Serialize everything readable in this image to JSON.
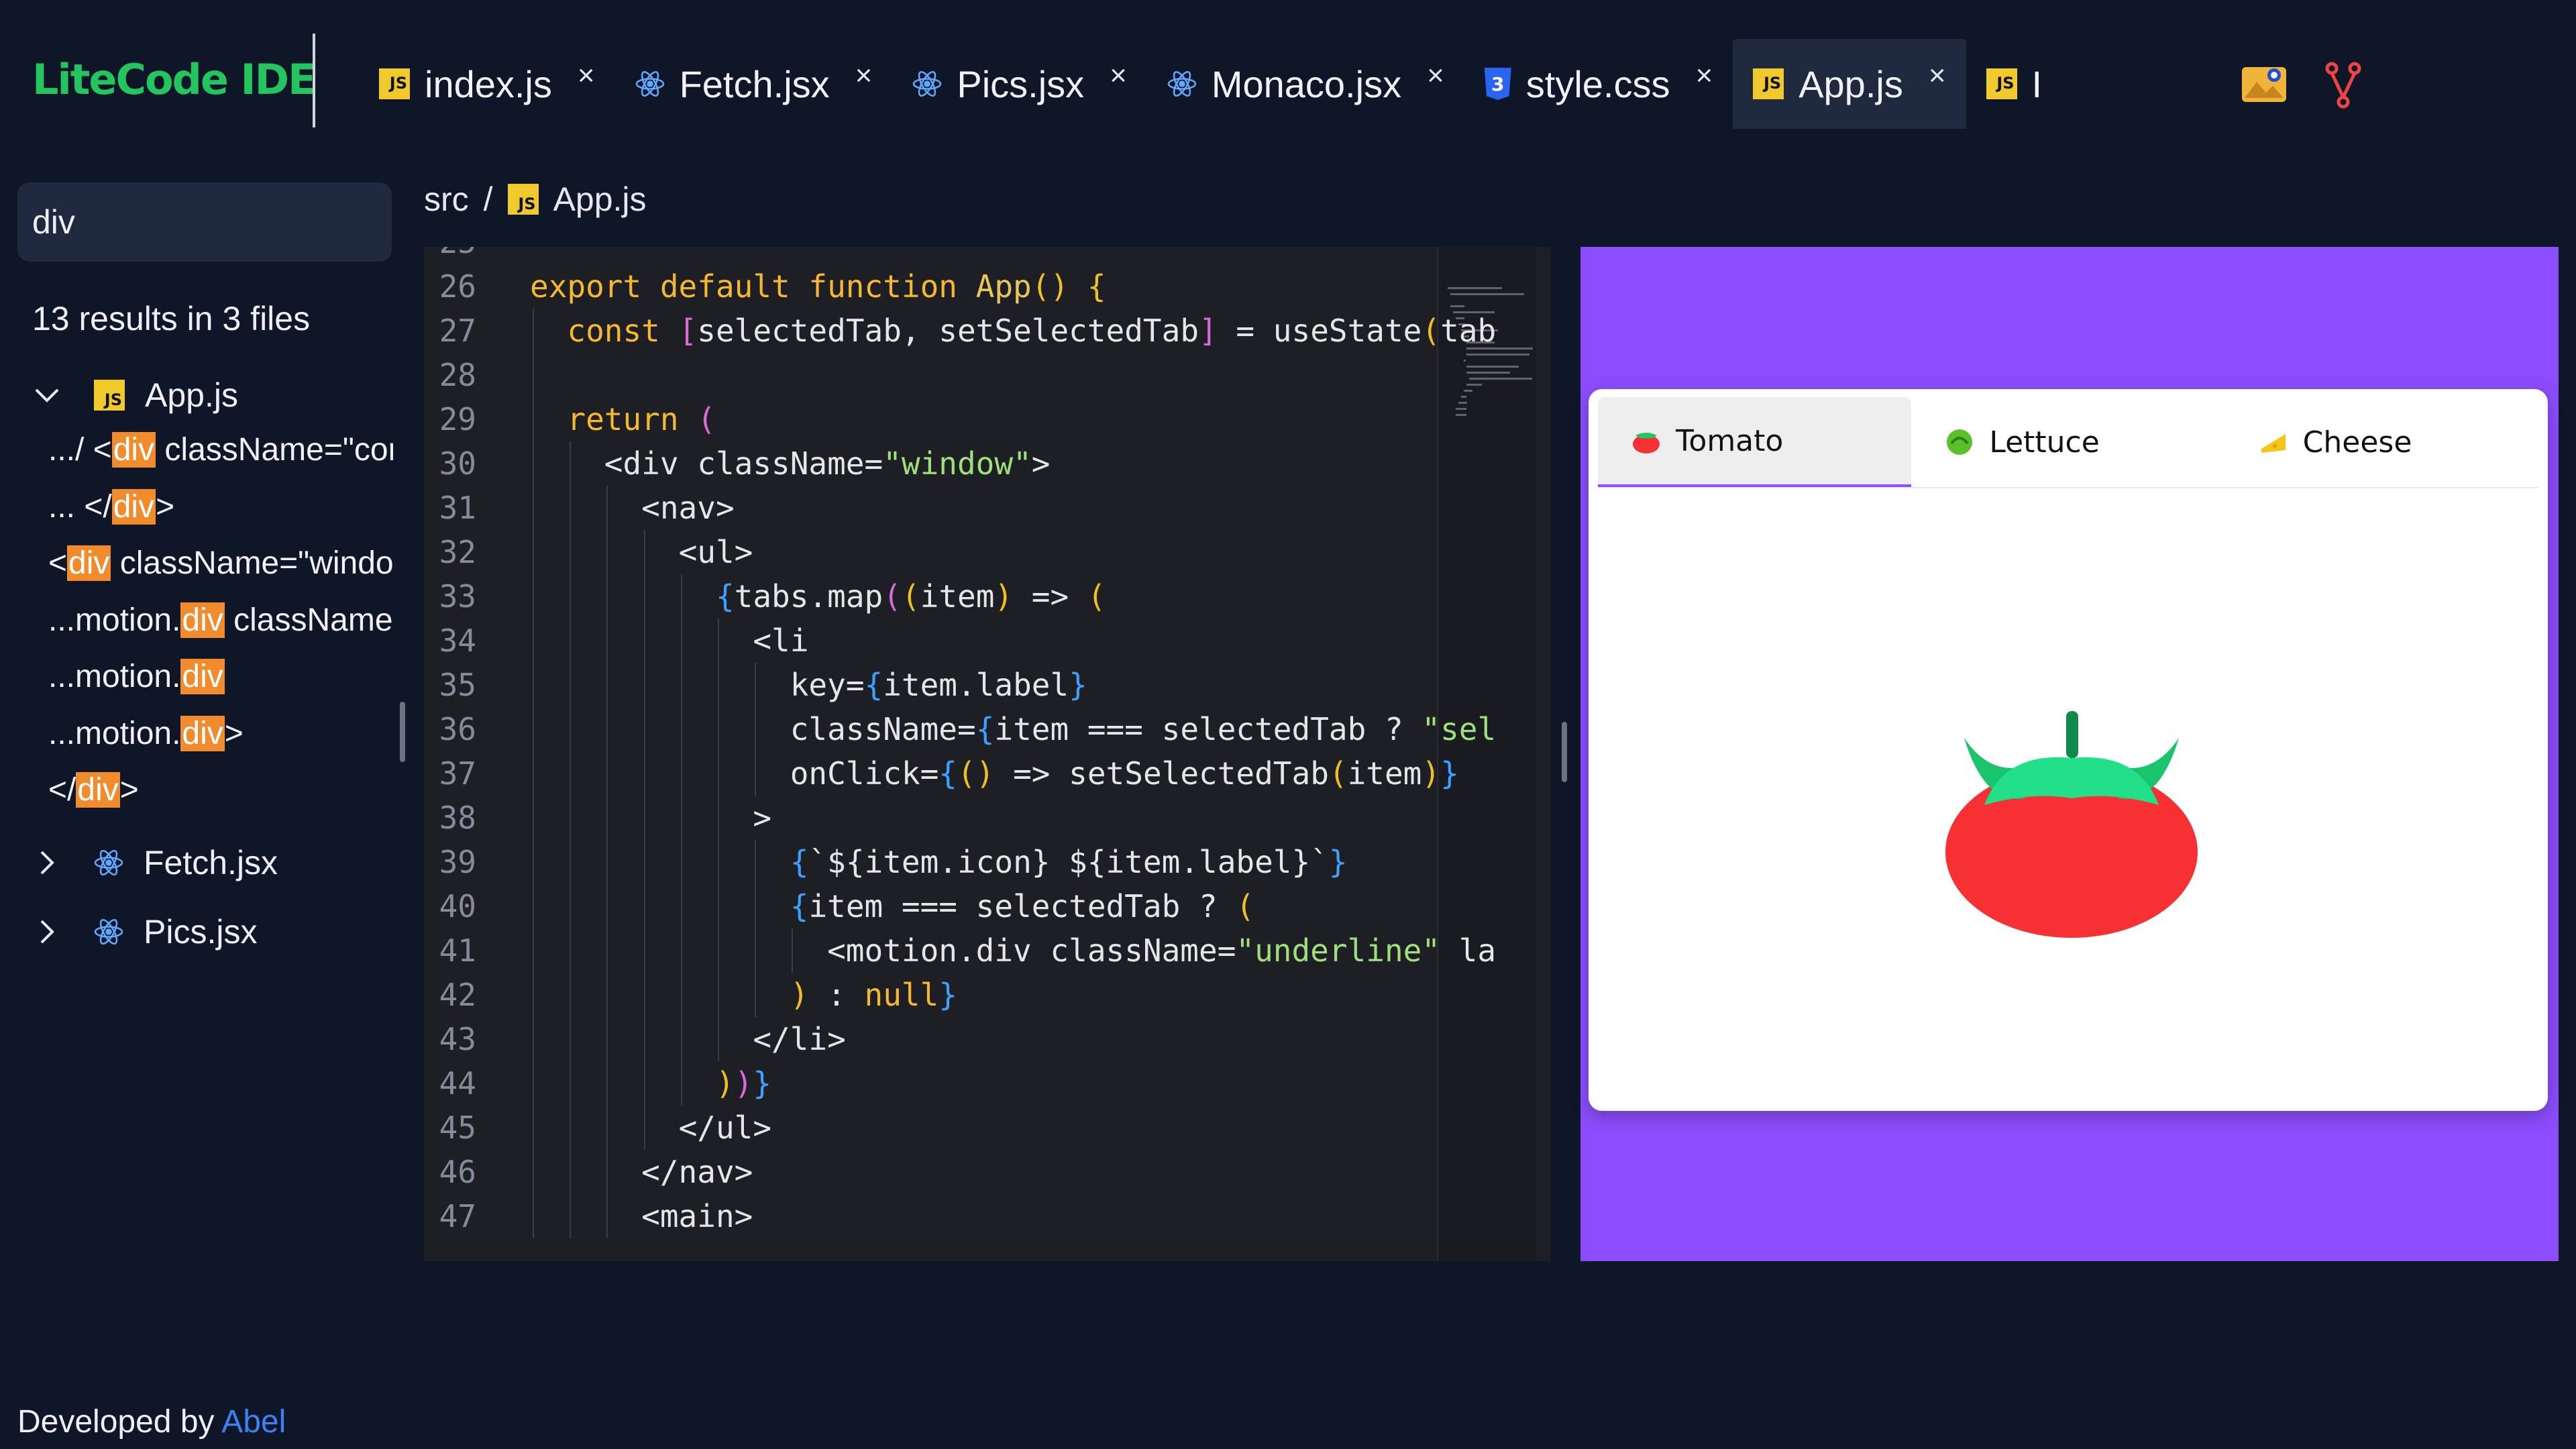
{
  "app": {
    "title": "LiteCode IDE"
  },
  "tabs": [
    {
      "label": "index.js",
      "icon": "js-file-icon"
    },
    {
      "label": "Fetch.jsx",
      "icon": "react-icon"
    },
    {
      "label": "Pics.jsx",
      "icon": "react-icon"
    },
    {
      "label": "Monaco.jsx",
      "icon": "react-icon"
    },
    {
      "label": "style.css",
      "icon": "css-file-icon"
    },
    {
      "label": "App.js",
      "icon": "js-file-icon",
      "active": true
    },
    {
      "label": "I",
      "icon": "js-file-icon"
    }
  ],
  "toolbar": {
    "icons": [
      "image-gallery-icon",
      "git-branch-icon"
    ]
  },
  "search": {
    "query": "div",
    "summary": "13 results in 3 files",
    "files": [
      {
        "name": "App.js",
        "expanded": true,
        "matches": [
          {
            "before": ".../ <",
            "hit": "div",
            "after": " className=\"cor"
          },
          {
            "before": "... </",
            "hit": "div",
            "after": ">"
          },
          {
            "before": "<",
            "hit": "div",
            "after": " className=\"windo"
          },
          {
            "before": "...motion.",
            "hit": "div",
            "after": " className"
          },
          {
            "before": "...motion.",
            "hit": "div",
            "after": ""
          },
          {
            "before": "...motion.",
            "hit": "div",
            "after": ">"
          },
          {
            "before": "</",
            "hit": "div",
            "after": ">"
          }
        ]
      },
      {
        "name": "Fetch.jsx",
        "expanded": false
      },
      {
        "name": "Pics.jsx",
        "expanded": false
      }
    ]
  },
  "breadcrumb": {
    "folder": "src",
    "separator": "/",
    "file": "App.js"
  },
  "editor": {
    "first_partial_line": "25",
    "lines": [
      {
        "n": "26",
        "indent": 0,
        "tokens": [
          [
            "export default function ",
            "kw"
          ],
          [
            "App",
            "fn"
          ],
          [
            "() {",
            "br"
          ]
        ]
      },
      {
        "n": "27",
        "indent": 1,
        "tokens": [
          [
            "const ",
            "kw"
          ],
          [
            "[",
            "br2"
          ],
          [
            "selectedTab, setSelectedTab",
            "tx"
          ],
          [
            "]",
            "br2"
          ],
          [
            " = useState",
            "tx"
          ],
          [
            "(",
            "br"
          ],
          [
            "tab",
            "tx"
          ]
        ]
      },
      {
        "n": "28",
        "indent": 0,
        "tokens": []
      },
      {
        "n": "29",
        "indent": 1,
        "tokens": [
          [
            "return ",
            "kw"
          ],
          [
            "(",
            "br2"
          ]
        ]
      },
      {
        "n": "30",
        "indent": 2,
        "tokens": [
          [
            "<div className=",
            "tx"
          ],
          [
            "\"window\"",
            "str"
          ],
          [
            ">",
            "tx"
          ]
        ]
      },
      {
        "n": "31",
        "indent": 3,
        "tokens": [
          [
            "<nav>",
            "tx"
          ]
        ]
      },
      {
        "n": "32",
        "indent": 4,
        "tokens": [
          [
            "<ul>",
            "tx"
          ]
        ]
      },
      {
        "n": "33",
        "indent": 5,
        "tokens": [
          [
            "{",
            "br3"
          ],
          [
            "tabs.map",
            "tx"
          ],
          [
            "(",
            "br2"
          ],
          [
            "(",
            "br"
          ],
          [
            "item",
            "tx"
          ],
          [
            ")",
            "br"
          ],
          [
            " => ",
            "tx"
          ],
          [
            "(",
            "br"
          ]
        ]
      },
      {
        "n": "34",
        "indent": 6,
        "tokens": [
          [
            "<li",
            "tx"
          ]
        ]
      },
      {
        "n": "35",
        "indent": 7,
        "tokens": [
          [
            "key=",
            "tx"
          ],
          [
            "{",
            "br3"
          ],
          [
            "item.label",
            "tx"
          ],
          [
            "}",
            "br3"
          ]
        ]
      },
      {
        "n": "36",
        "indent": 7,
        "tokens": [
          [
            "className=",
            "tx"
          ],
          [
            "{",
            "br3"
          ],
          [
            "item === selectedTab ? ",
            "tx"
          ],
          [
            "\"sel",
            "str"
          ]
        ]
      },
      {
        "n": "37",
        "indent": 7,
        "tokens": [
          [
            "onClick=",
            "tx"
          ],
          [
            "{",
            "br3"
          ],
          [
            "()",
            "br"
          ],
          [
            " => setSelectedTab",
            "tx"
          ],
          [
            "(",
            "br"
          ],
          [
            "item",
            "tx"
          ],
          [
            ")",
            "br"
          ],
          [
            "}",
            "br3"
          ]
        ]
      },
      {
        "n": "38",
        "indent": 6,
        "tokens": [
          [
            ">",
            "tx"
          ]
        ]
      },
      {
        "n": "39",
        "indent": 7,
        "tokens": [
          [
            "{",
            "br3"
          ],
          [
            "`${item.icon} ${item.label}`",
            "tx"
          ],
          [
            "}",
            "br3"
          ]
        ]
      },
      {
        "n": "40",
        "indent": 7,
        "tokens": [
          [
            "{",
            "br3"
          ],
          [
            "item === selectedTab ? ",
            "tx"
          ],
          [
            "(",
            "br"
          ]
        ]
      },
      {
        "n": "41",
        "indent": 8,
        "tokens": [
          [
            "<motion.div className=",
            "tx"
          ],
          [
            "\"underline\"",
            "str"
          ],
          [
            " la",
            "tx"
          ]
        ]
      },
      {
        "n": "42",
        "indent": 7,
        "tokens": [
          [
            ")",
            "br"
          ],
          [
            " : ",
            "tx"
          ],
          [
            "null",
            "kw"
          ],
          [
            "}",
            "br3"
          ]
        ]
      },
      {
        "n": "43",
        "indent": 6,
        "tokens": [
          [
            "</li>",
            "tx"
          ]
        ]
      },
      {
        "n": "44",
        "indent": 5,
        "tokens": [
          [
            ")",
            "br"
          ],
          [
            ")",
            "br2"
          ],
          [
            "}",
            "br3"
          ]
        ]
      },
      {
        "n": "45",
        "indent": 4,
        "tokens": [
          [
            "</ul>",
            "tx"
          ]
        ]
      },
      {
        "n": "46",
        "indent": 3,
        "tokens": [
          [
            "</nav>",
            "tx"
          ]
        ]
      },
      {
        "n": "47",
        "indent": 3,
        "tokens": [
          [
            "<main>",
            "tx"
          ]
        ]
      }
    ]
  },
  "preview": {
    "background": "#8b4dfb",
    "tabs": [
      {
        "label": "Tomato",
        "icon": "tomato-icon",
        "active": true
      },
      {
        "label": "Lettuce",
        "icon": "lettuce-icon",
        "active": false
      },
      {
        "label": "Cheese",
        "icon": "cheese-icon",
        "active": false
      }
    ],
    "content_icon": "tomato-icon"
  },
  "footer": {
    "prefix": "Developed by",
    "author": "Abel"
  },
  "colors": {
    "brand": "#22c55e",
    "highlight": "#f28b2c",
    "link": "#3b82f6",
    "keyword": "#f5b82e",
    "function": "#e8c65a",
    "string": "#9fe07a",
    "bracket_gold": "#f0c020",
    "bracket_pink": "#d86bd8",
    "bracket_blue": "#3ca0ff"
  }
}
